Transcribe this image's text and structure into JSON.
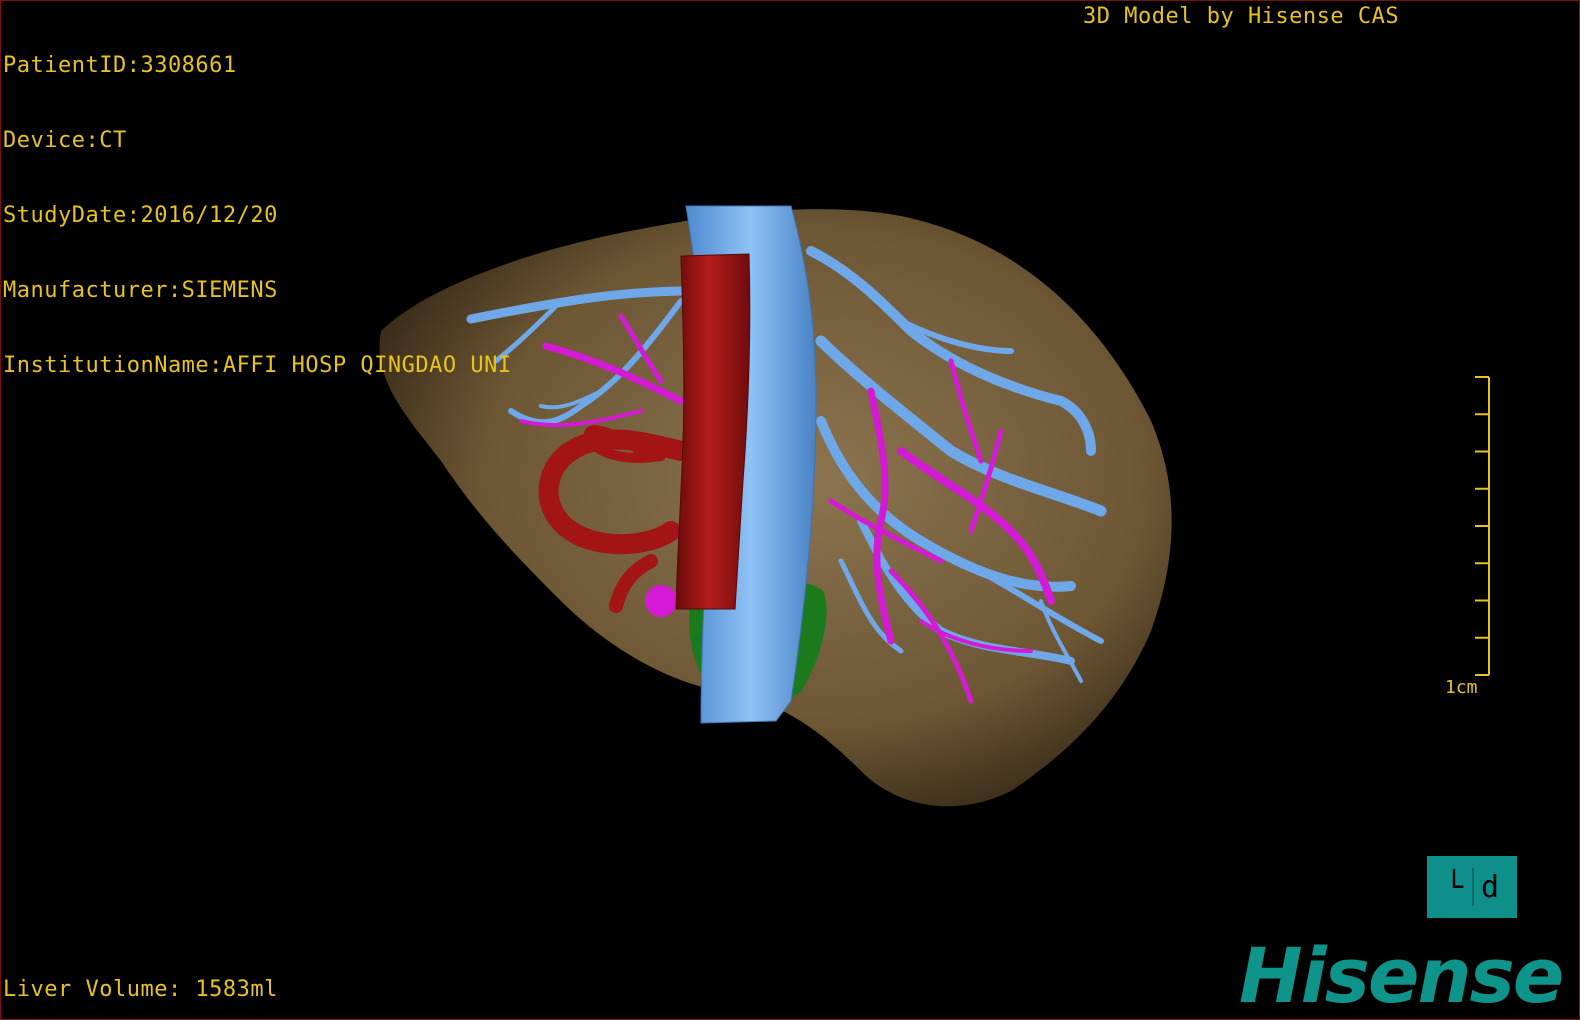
{
  "header": {
    "patient_id": "PatientID:3308661",
    "device": "Device:CT",
    "study_date": "StudyDate:2016/12/20",
    "manufacturer": "Manufacturer:SIEMENS",
    "institution": "InstitutionName:AFFI HOSP QINGDAO UNI",
    "model_credit": "3D Model by Hisense CAS"
  },
  "footer": {
    "liver_volume": "Liver Volume: 1583ml"
  },
  "scale_bar": {
    "label": "1cm",
    "ticks": 9
  },
  "orientation_cube": {
    "label": "└ d"
  },
  "brand": {
    "logo_text": "Hisense"
  },
  "colors": {
    "overlay_text": "#e9c21e",
    "liver": "#7a6440",
    "portal_vein": "#6fa8e8",
    "hepatic_artery": "#a31414",
    "hepatic_vein": "#d41ad4",
    "gallbladder": "#1b7a1b",
    "brand": "#0f948c"
  },
  "structures": [
    "liver-surface",
    "inferior-vena-cava",
    "aorta",
    "portal-vein-branches",
    "hepatic-vein-branches",
    "gallbladder"
  ]
}
